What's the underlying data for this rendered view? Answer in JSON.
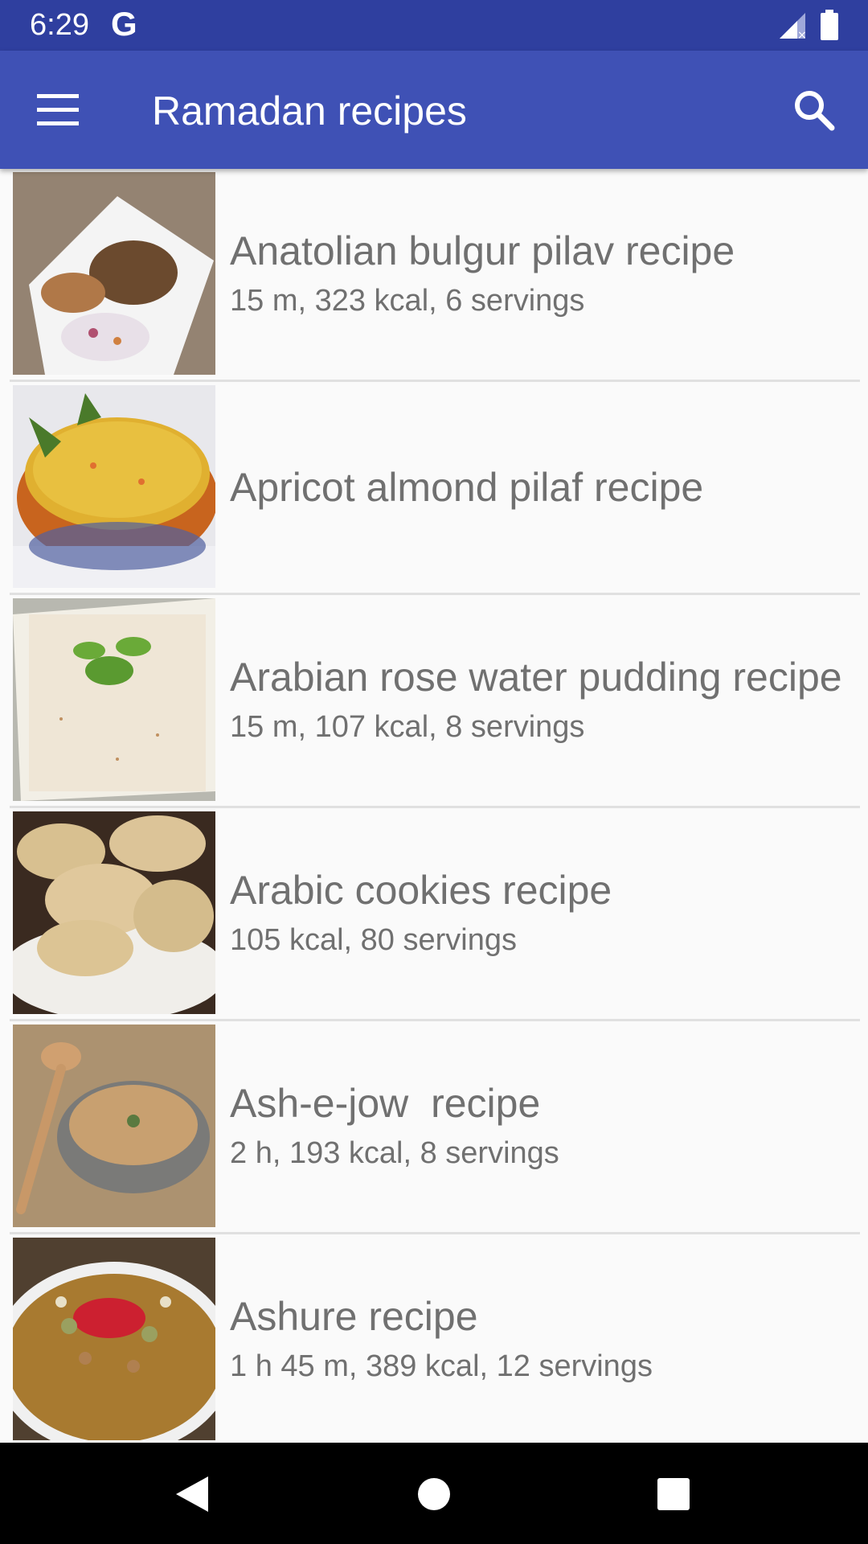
{
  "status_bar": {
    "time": "6:29",
    "notification_icon": "G",
    "signal_icon": "signal-no-data-icon",
    "battery_icon": "battery-full-icon"
  },
  "app_bar": {
    "title": "Ramadan recipes",
    "menu_icon": "hamburger-menu-icon",
    "search_icon": "search-icon",
    "background_color": "#3f51b5",
    "status_bar_color": "#2f3f9f"
  },
  "recipes": [
    {
      "title": "Anatolian bulgur pilav recipe",
      "meta": "15 m, 323 kcal, 6 servings",
      "image": "bulgur-pilav-photo"
    },
    {
      "title": "Apricot almond pilaf recipe",
      "meta": "",
      "image": "apricot-pilaf-photo"
    },
    {
      "title": "Arabian rose water pudding recipe",
      "meta": "15 m, 107 kcal, 8 servings",
      "image": "rose-pudding-photo"
    },
    {
      "title": "Arabic cookies recipe",
      "meta": "105 kcal, 80 servings",
      "image": "arabic-cookies-photo"
    },
    {
      "title": "Ash-e-jow  recipe",
      "meta": "2 h, 193 kcal, 8 servings",
      "image": "ash-e-jow-photo"
    },
    {
      "title": "Ashure recipe",
      "meta": "1 h 45 m, 389 kcal, 12 servings",
      "image": "ashure-photo"
    }
  ],
  "nav_bar": {
    "back_icon": "back-triangle-icon",
    "home_icon": "home-circle-icon",
    "recents_icon": "recents-square-icon"
  }
}
